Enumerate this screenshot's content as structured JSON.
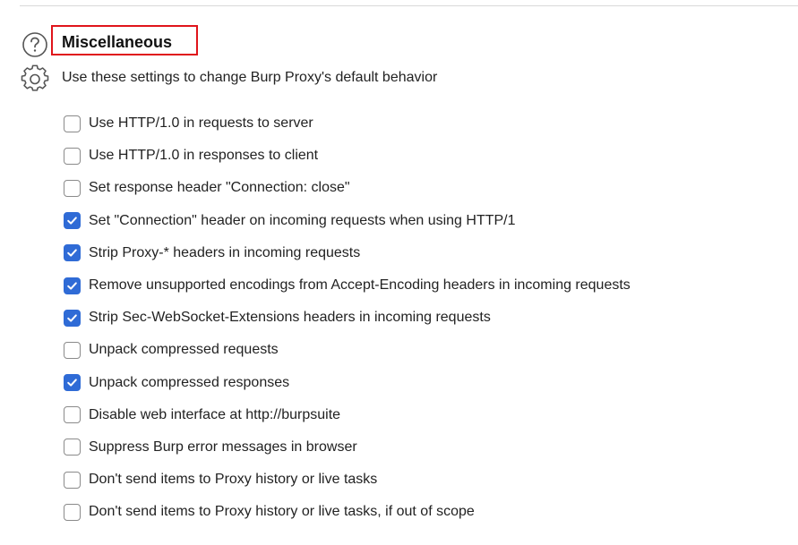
{
  "section": {
    "title": "Miscellaneous",
    "description": "Use these settings to change Burp Proxy's default behavior",
    "help_icon": "question-circle-icon",
    "settings_icon": "gear-icon",
    "highlight_color": "#e0141b"
  },
  "accent_color": "#2f6bd6",
  "options": [
    {
      "label": "Use HTTP/1.0 in requests to server",
      "checked": false
    },
    {
      "label": "Use HTTP/1.0 in responses to client",
      "checked": false
    },
    {
      "label": "Set response header \"Connection: close\"",
      "checked": false
    },
    {
      "label": "Set \"Connection\" header on incoming requests when using HTTP/1",
      "checked": true
    },
    {
      "label": "Strip Proxy-* headers in incoming requests",
      "checked": true
    },
    {
      "label": "Remove unsupported encodings from Accept-Encoding headers in incoming requests",
      "checked": true
    },
    {
      "label": "Strip Sec-WebSocket-Extensions headers in incoming requests",
      "checked": true
    },
    {
      "label": "Unpack compressed requests",
      "checked": false
    },
    {
      "label": "Unpack compressed responses",
      "checked": true
    },
    {
      "label": "Disable web interface at http://burpsuite",
      "checked": false
    },
    {
      "label": "Suppress Burp error messages in browser",
      "checked": false
    },
    {
      "label": "Don't send items to Proxy history or live tasks",
      "checked": false
    },
    {
      "label": "Don't send items to Proxy history or live tasks, if out of scope",
      "checked": false
    }
  ]
}
